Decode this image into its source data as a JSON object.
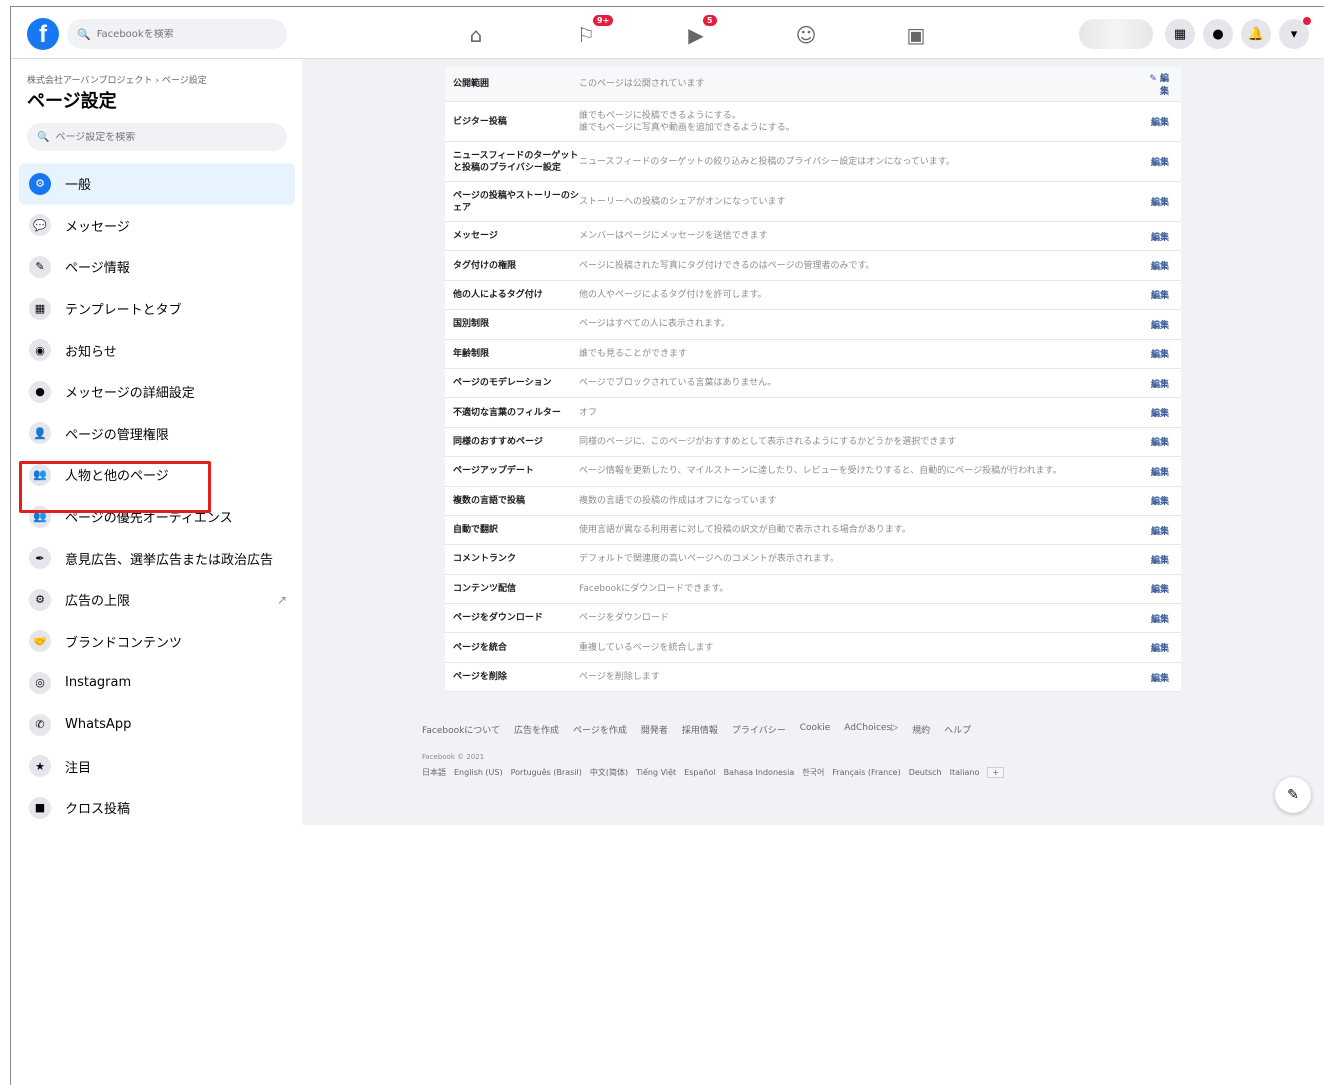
{
  "topbar": {
    "logo": "f",
    "search_placeholder": "Facebookを検索",
    "badges": {
      "notifications": "9+",
      "watch": "5"
    }
  },
  "sidebar": {
    "breadcrumb": "株式会社アーバンプロジェクト › ページ設定",
    "title": "ページ設定",
    "search_placeholder": "ページ設定を検索",
    "items": [
      {
        "label": "一般",
        "icon": "gear-icon",
        "glyph": "⚙"
      },
      {
        "label": "メッセージ",
        "icon": "chat-icon",
        "glyph": "💬"
      },
      {
        "label": "ページ情報",
        "icon": "pencil-icon",
        "glyph": "✎"
      },
      {
        "label": "テンプレートとタブ",
        "icon": "grid-icon",
        "glyph": "▦"
      },
      {
        "label": "お知らせ",
        "icon": "globe-icon",
        "glyph": "◉"
      },
      {
        "label": "メッセージの詳細設定",
        "icon": "messenger-icon",
        "glyph": "●"
      },
      {
        "label": "ページの管理権限",
        "icon": "person-icon",
        "glyph": "👤"
      },
      {
        "label": "人物と他のページ",
        "icon": "people-icon",
        "glyph": "👥"
      },
      {
        "label": "ページの優先オーディエンス",
        "icon": "audience-icon",
        "glyph": "👥"
      },
      {
        "label": "意見広告、選挙広告または政治広告",
        "icon": "megaphone-icon",
        "glyph": "✒"
      },
      {
        "label": "広告の上限",
        "icon": "gear-icon",
        "glyph": "⚙"
      },
      {
        "label": "ブランドコンテンツ",
        "icon": "handshake-icon",
        "glyph": "🤝"
      },
      {
        "label": "Instagram",
        "icon": "instagram-icon",
        "glyph": "◎"
      },
      {
        "label": "WhatsApp",
        "icon": "whatsapp-icon",
        "glyph": "✆"
      },
      {
        "label": "注目",
        "icon": "star-icon",
        "glyph": "★"
      },
      {
        "label": "クロス投稿",
        "icon": "video-icon",
        "glyph": "■"
      }
    ]
  },
  "settings": {
    "edit_label": "編集",
    "rows": [
      {
        "label": "公開範囲",
        "value": "このページは公開されています",
        "tall": false
      },
      {
        "label": "ビジター投稿",
        "value": "誰でもページに投稿できるようにする。\n誰でもページに写真や動画を追加できるようにする。",
        "tall": true
      },
      {
        "label": "ニュースフィードのターゲットと投稿のプライバシー設定",
        "value": "ニュースフィードのターゲットの絞り込みと投稿のプライバシー設定はオンになっています。",
        "tall": true
      },
      {
        "label": "ページの投稿やストーリーのシェア",
        "value": "ストーリーへの投稿のシェアがオンになっています",
        "tall": true
      },
      {
        "label": "メッセージ",
        "value": "メンバーはページにメッセージを送信できます",
        "tall": false
      },
      {
        "label": "タグ付けの権限",
        "value": "ページに投稿された写真にタグ付けできるのはページの管理者のみです。",
        "tall": false
      },
      {
        "label": "他の人によるタグ付け",
        "value": "他の人やページによるタグ付けを許可します。",
        "tall": false
      },
      {
        "label": "国別制限",
        "value": "ページはすべての人に表示されます。",
        "tall": false
      },
      {
        "label": "年齢制限",
        "value": "誰でも見ることができます",
        "tall": false
      },
      {
        "label": "ページのモデレーション",
        "value": "ページでブロックされている言葉はありません。",
        "tall": false
      },
      {
        "label": "不適切な言葉のフィルター",
        "value": "オフ",
        "tall": false
      },
      {
        "label": "同様のおすすめページ",
        "value": "同様のページに、このページがおすすめとして表示されるようにするかどうかを選択できます",
        "tall": false
      },
      {
        "label": "ページアップデート",
        "value": "ページ情報を更新したり、マイルストーンに達したり、レビューを受けたりすると、自動的にページ投稿が行われます。",
        "tall": false
      },
      {
        "label": "複数の言語で投稿",
        "value": "複数の言語での投稿の作成はオフになっています",
        "tall": false
      },
      {
        "label": "自動で翻訳",
        "value": "使用言語が異なる利用者に対して投稿の訳文が自動で表示される場合があります。",
        "tall": false
      },
      {
        "label": "コメントランク",
        "value": "デフォルトで関連度の高いページへのコメントが表示されます。",
        "tall": false
      },
      {
        "label": "コンテンツ配信",
        "value": "Facebookにダウンロードできます。",
        "tall": false
      },
      {
        "label": "ページをダウンロード",
        "value": "ページをダウンロード",
        "tall": false
      },
      {
        "label": "ページを統合",
        "value": "重複しているページを統合します",
        "tall": false
      },
      {
        "label": "ページを削除",
        "value": "ページを削除します",
        "tall": false
      }
    ]
  },
  "footer": {
    "links": [
      "Facebookについて",
      "広告を作成",
      "ページを作成",
      "開発者",
      "採用情報",
      "プライバシー",
      "Cookie",
      "AdChoices▷",
      "規約",
      "ヘルプ"
    ],
    "copyright": "Facebook © 2021",
    "languages": [
      "日本語",
      "English (US)",
      "Português (Brasil)",
      "中文(简体)",
      "Tiếng Việt",
      "Español",
      "Bahasa Indonesia",
      "한국어",
      "Français (France)",
      "Deutsch",
      "Italiano"
    ],
    "more": "+"
  }
}
